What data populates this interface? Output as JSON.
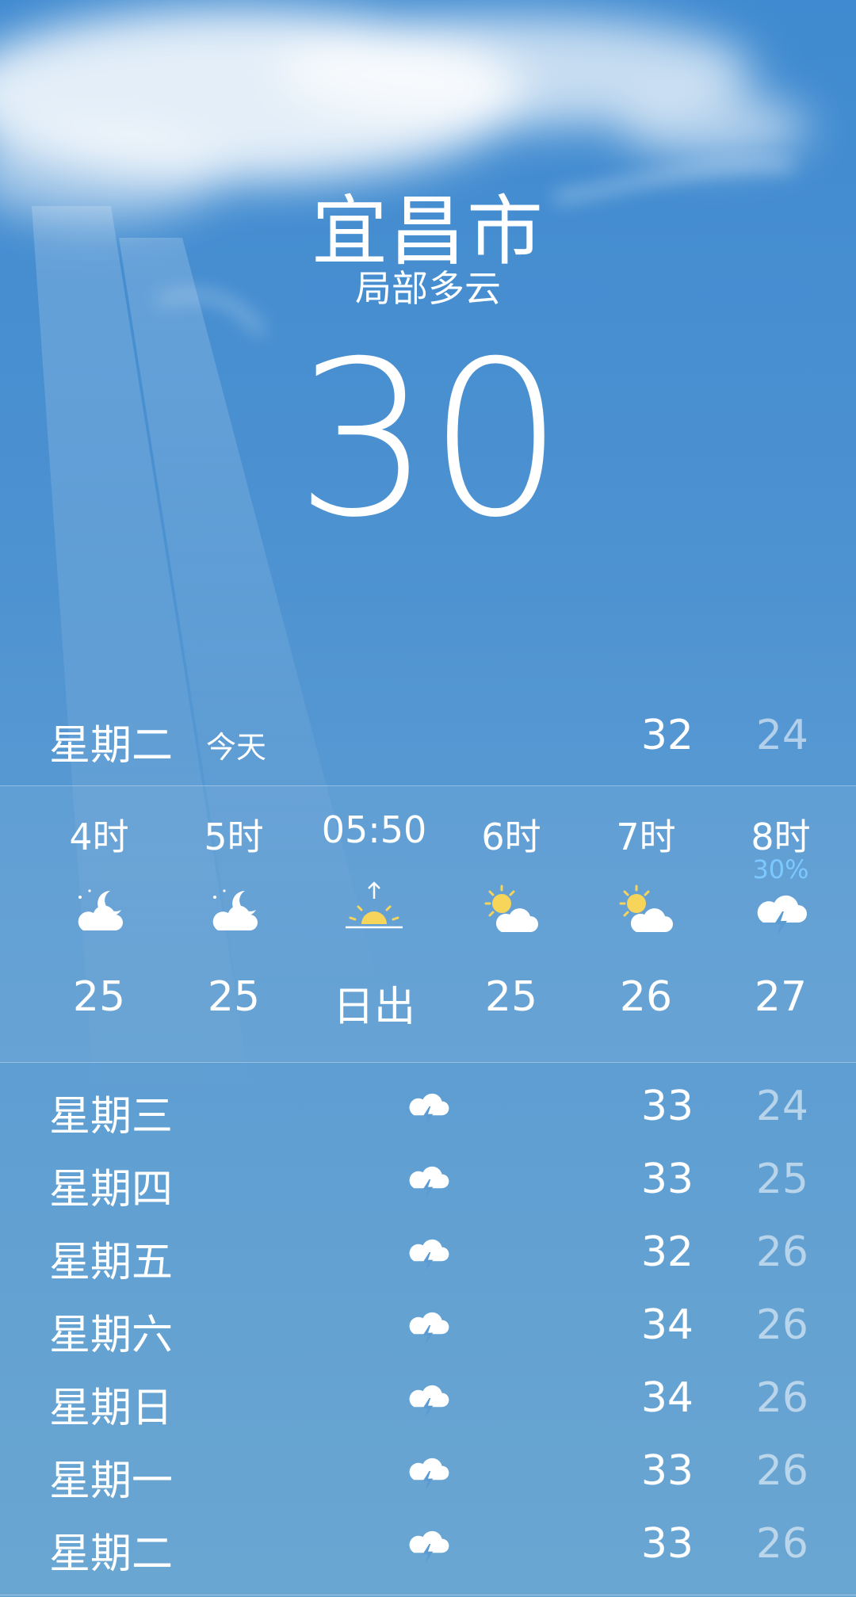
{
  "location": {
    "city": "宜昌市",
    "condition": "局部多云",
    "temperature": "30"
  },
  "today": {
    "day": "星期二",
    "tag": "今天",
    "high": "32",
    "low": "24"
  },
  "hourly": [
    {
      "label": "4时",
      "icon": "moon-cloud-icon",
      "value": "25"
    },
    {
      "label": "5时",
      "icon": "moon-cloud-icon",
      "value": "25"
    },
    {
      "label": "05:50",
      "icon": "sunrise-icon",
      "value": "日出"
    },
    {
      "label": "6时",
      "icon": "sun-cloud-icon",
      "value": "25"
    },
    {
      "label": "7时",
      "icon": "sun-cloud-icon",
      "value": "26"
    },
    {
      "label": "8时",
      "icon": "thunderstorm-icon",
      "value": "27",
      "precip": "30%"
    }
  ],
  "daily": [
    {
      "day": "星期三",
      "icon": "thunderstorm-icon",
      "high": "33",
      "low": "24"
    },
    {
      "day": "星期四",
      "icon": "thunderstorm-icon",
      "high": "33",
      "low": "25"
    },
    {
      "day": "星期五",
      "icon": "thunderstorm-icon",
      "high": "32",
      "low": "26"
    },
    {
      "day": "星期六",
      "icon": "thunderstorm-icon",
      "high": "34",
      "low": "26"
    },
    {
      "day": "星期日",
      "icon": "thunderstorm-icon",
      "high": "34",
      "low": "26"
    },
    {
      "day": "星期一",
      "icon": "thunderstorm-icon",
      "high": "33",
      "low": "26"
    },
    {
      "day": "星期二",
      "icon": "thunderstorm-icon",
      "high": "33",
      "low": "26"
    }
  ],
  "colors": {
    "sky_top": "#3f8ad0",
    "sky_bottom": "#6aa6d2",
    "precip_text": "#7cc8ff",
    "sun": "#f7d45a"
  }
}
